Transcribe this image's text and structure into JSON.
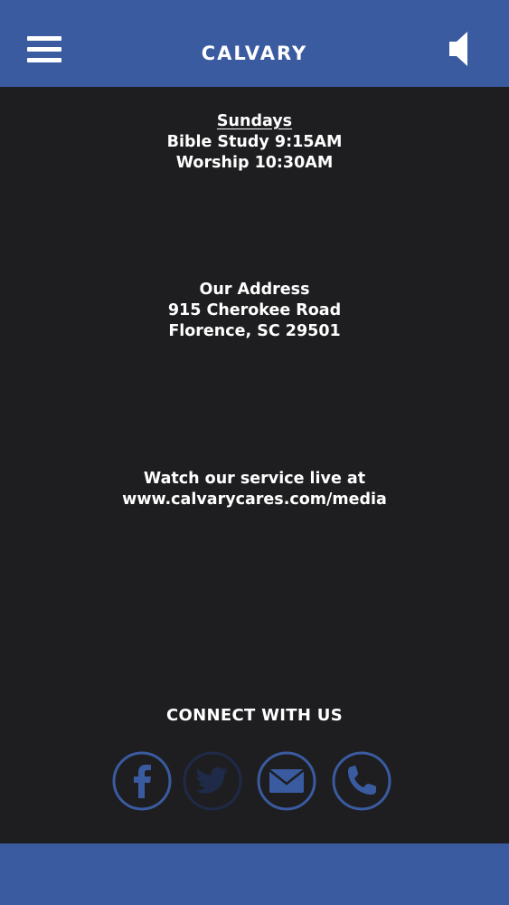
{
  "header": {
    "title": "CALVARY",
    "menu_icon": "hamburger-menu-icon",
    "audio_icon": "speaker-icon"
  },
  "schedule": {
    "heading": "Sundays",
    "line1": "Bible Study 9:15AM",
    "line2": "Worship 10:30AM"
  },
  "address": {
    "heading": "Our Address",
    "line1": "915 Cherokee Road",
    "line2": "Florence, SC 29501"
  },
  "livestream": {
    "line1": "Watch our service live at",
    "line2": "www.calvarycares.com/media"
  },
  "connect": {
    "title": "CONNECT WITH US",
    "links": [
      {
        "icon": "facebook-icon",
        "color": "#3a5ba0"
      },
      {
        "icon": "twitter-icon",
        "color": "#1f2a48"
      },
      {
        "icon": "email-icon",
        "color": "#3a5ba0"
      },
      {
        "icon": "phone-icon",
        "color": "#3a5ba0"
      }
    ]
  },
  "colors": {
    "brand": "#3a5ba0",
    "background": "#1e1e20",
    "text": "#ffffff"
  }
}
